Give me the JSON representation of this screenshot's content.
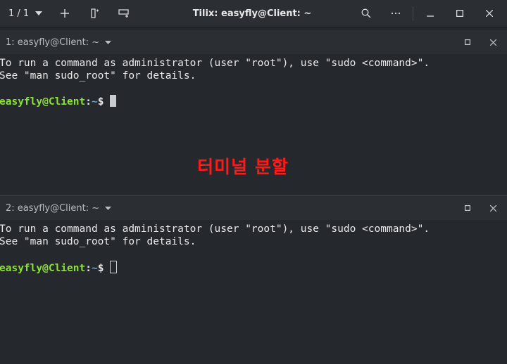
{
  "header": {
    "session_counter": "1 / 1",
    "title": "Tilix: easyfly@Client: ~",
    "icons": {
      "session_menu": "chevron-down-icon",
      "add_session": "plus-icon",
      "add_terminal_right": "split-right-icon",
      "add_terminal_down": "split-down-icon",
      "search": "search-icon",
      "menu": "ellipsis-icon",
      "minimize": "minimize-icon",
      "maximize": "maximize-icon",
      "close": "close-icon"
    }
  },
  "panes": [
    {
      "title": "1: easyfly@Client: ~",
      "lines": [
        "To run a command as administrator (user \"root\"), use \"sudo <command>\".",
        "See \"man sudo_root\" for details."
      ],
      "prompt": {
        "user_host": "easyfly@Client",
        "separator": ":",
        "path": "~",
        "symbol": "$"
      },
      "cursor": "focused-block"
    },
    {
      "title": "2: easyfly@Client: ~",
      "lines": [
        "To run a command as administrator (user \"root\"), use \"sudo <command>\".",
        "See \"man sudo_root\" for details."
      ],
      "prompt": {
        "user_host": "easyfly@Client",
        "separator": ":",
        "path": "~",
        "symbol": "$"
      },
      "cursor": "unfocused-outline"
    }
  ],
  "overlay_caption": "터미널 분할",
  "colors": {
    "background": "#25282c",
    "headerbar": "#2b2e33",
    "prompt_user": "#8ae234",
    "prompt_path": "#729fcf",
    "caption": "#ff1a1a"
  }
}
